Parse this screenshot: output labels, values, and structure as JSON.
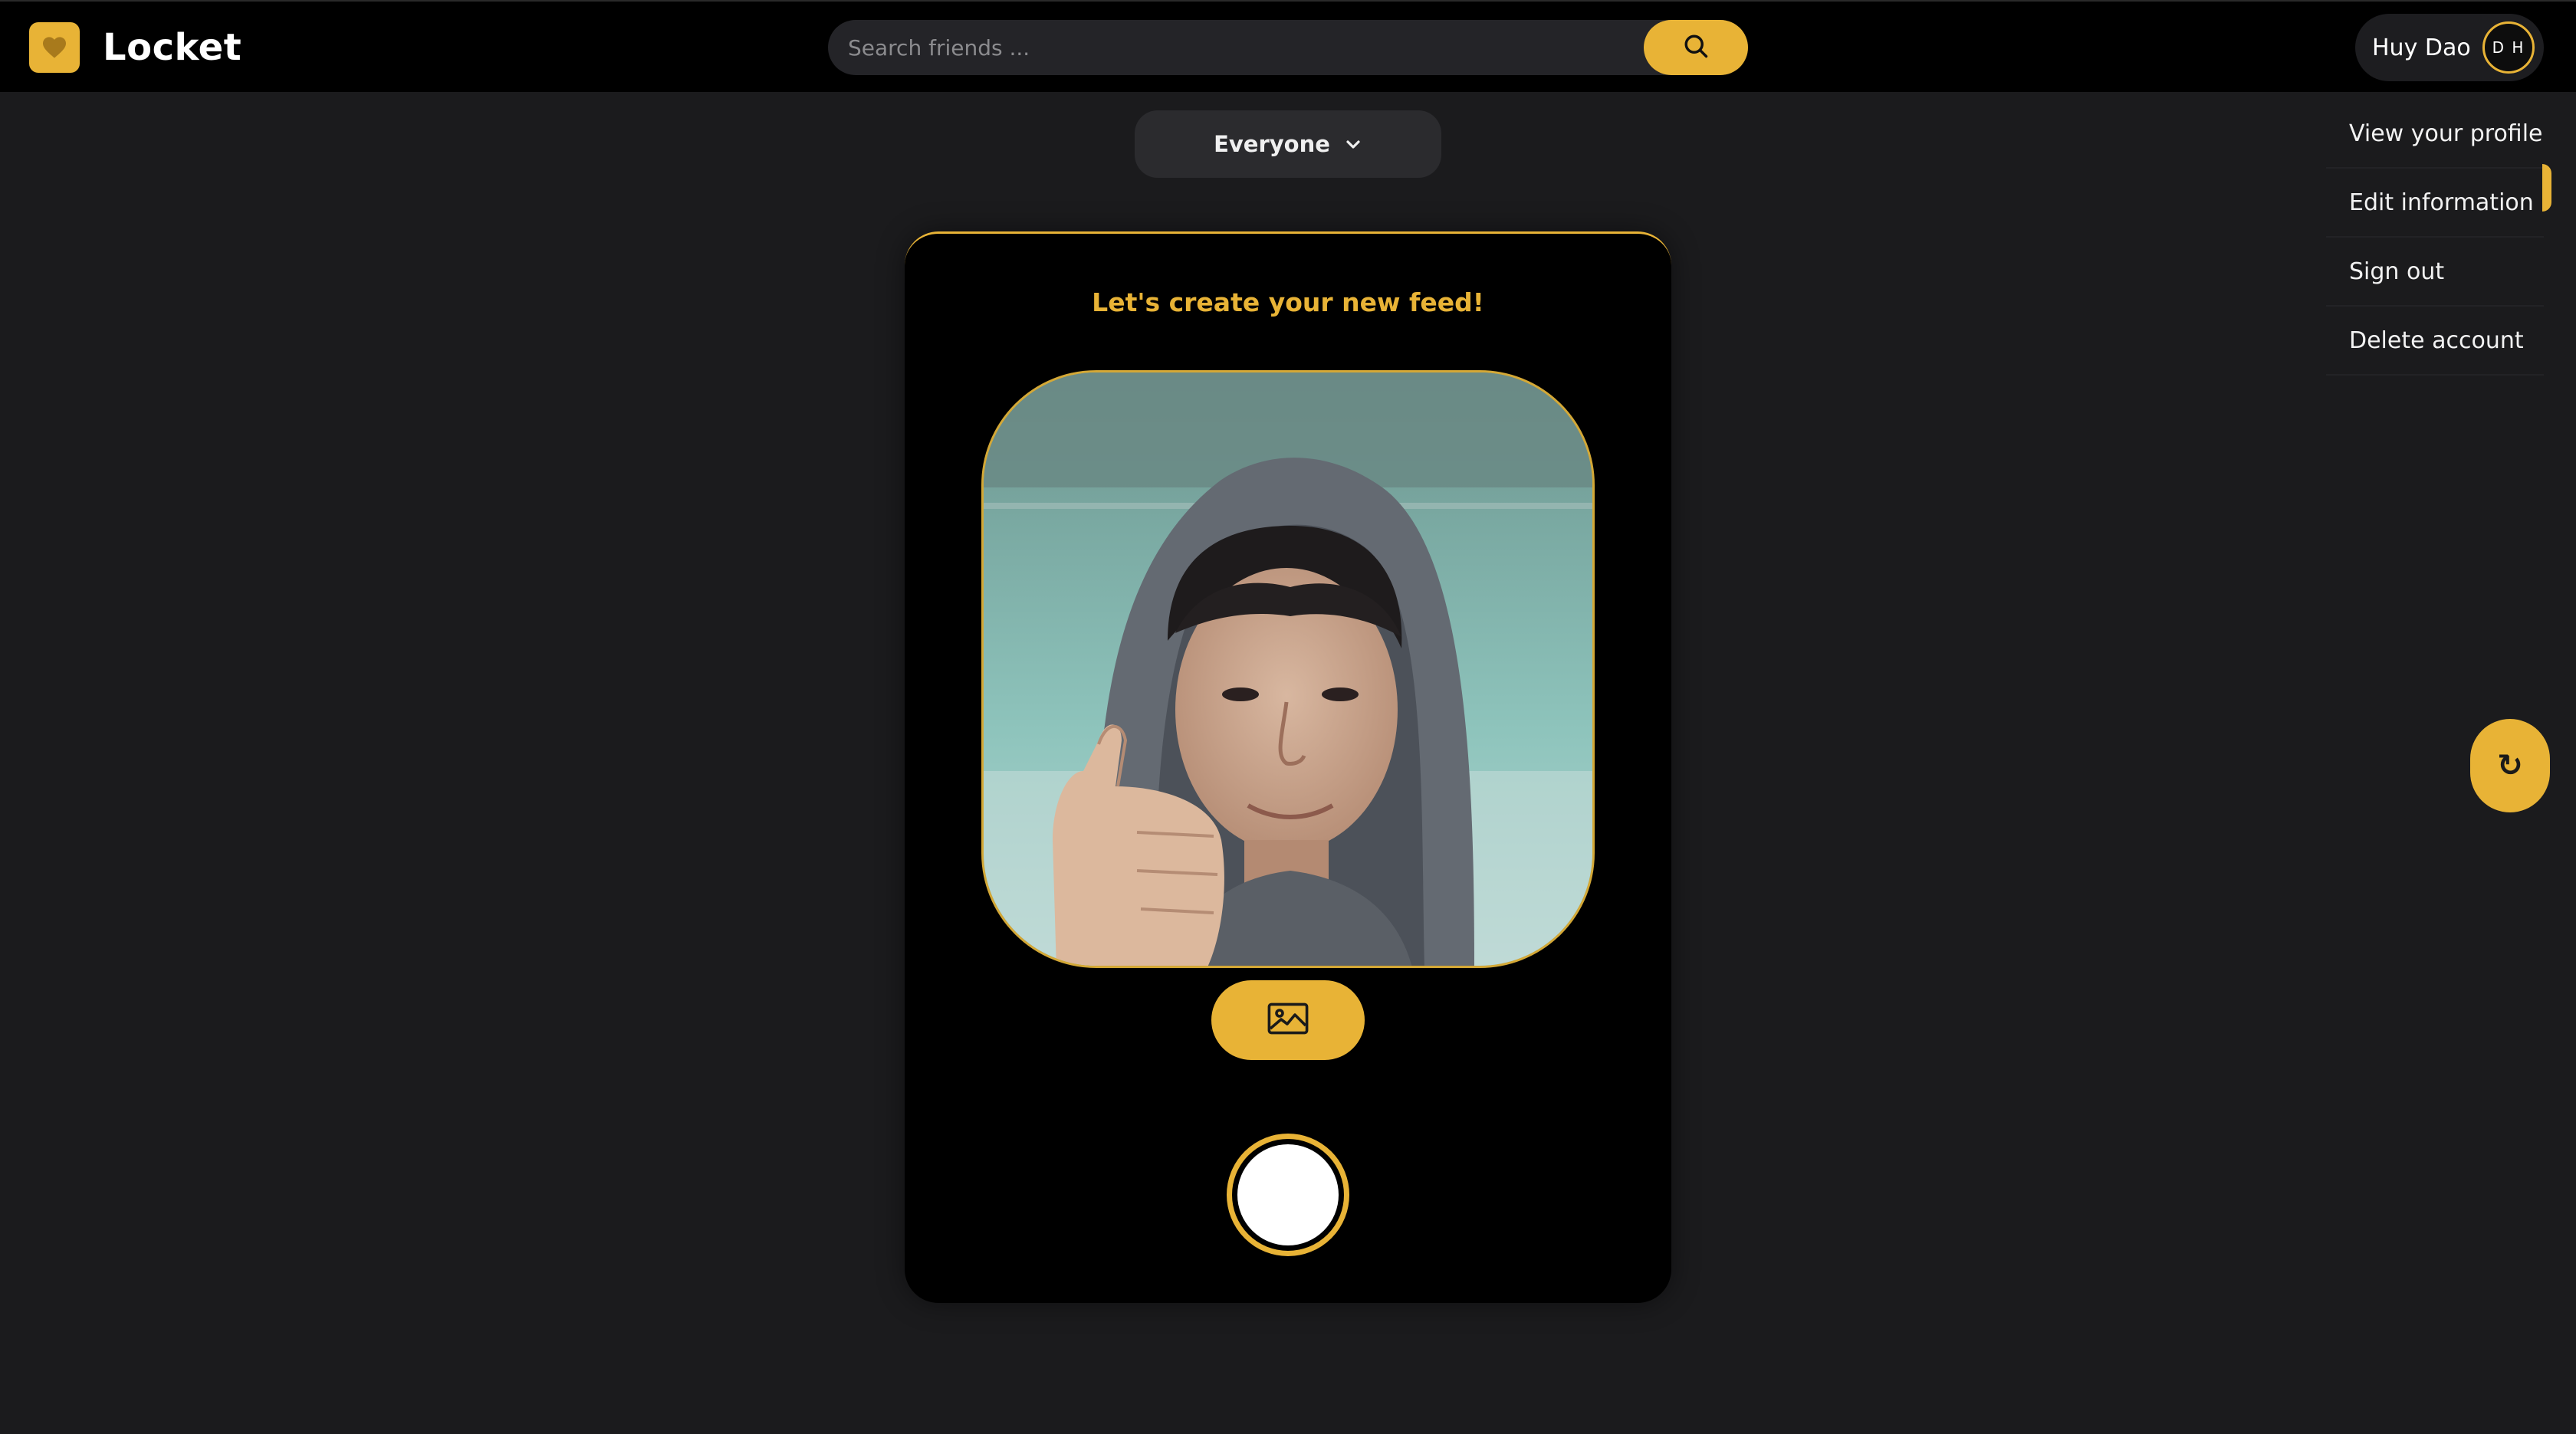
{
  "app": {
    "name": "Locket",
    "brand_color": "#e8b336",
    "logo_icon": "heart-icon"
  },
  "header": {
    "search": {
      "placeholder": "Search friends ...",
      "value": "",
      "button_icon": "search-icon"
    },
    "user": {
      "name": "Huy Dao",
      "initials": "D H"
    }
  },
  "user_menu": {
    "items": [
      {
        "label": "View your profile"
      },
      {
        "label": "Edit information"
      },
      {
        "label": "Sign out"
      },
      {
        "label": "Delete account"
      }
    ]
  },
  "audience_selector": {
    "value": "Everyone",
    "icon": "chevron-down-icon"
  },
  "camera_card": {
    "title": "Let's create your new feed!",
    "preview": "camera-preview",
    "gallery_icon": "image-icon",
    "shutter": "capture"
  },
  "floating_action": {
    "icon": "refresh-icon",
    "glyph": "↻"
  }
}
